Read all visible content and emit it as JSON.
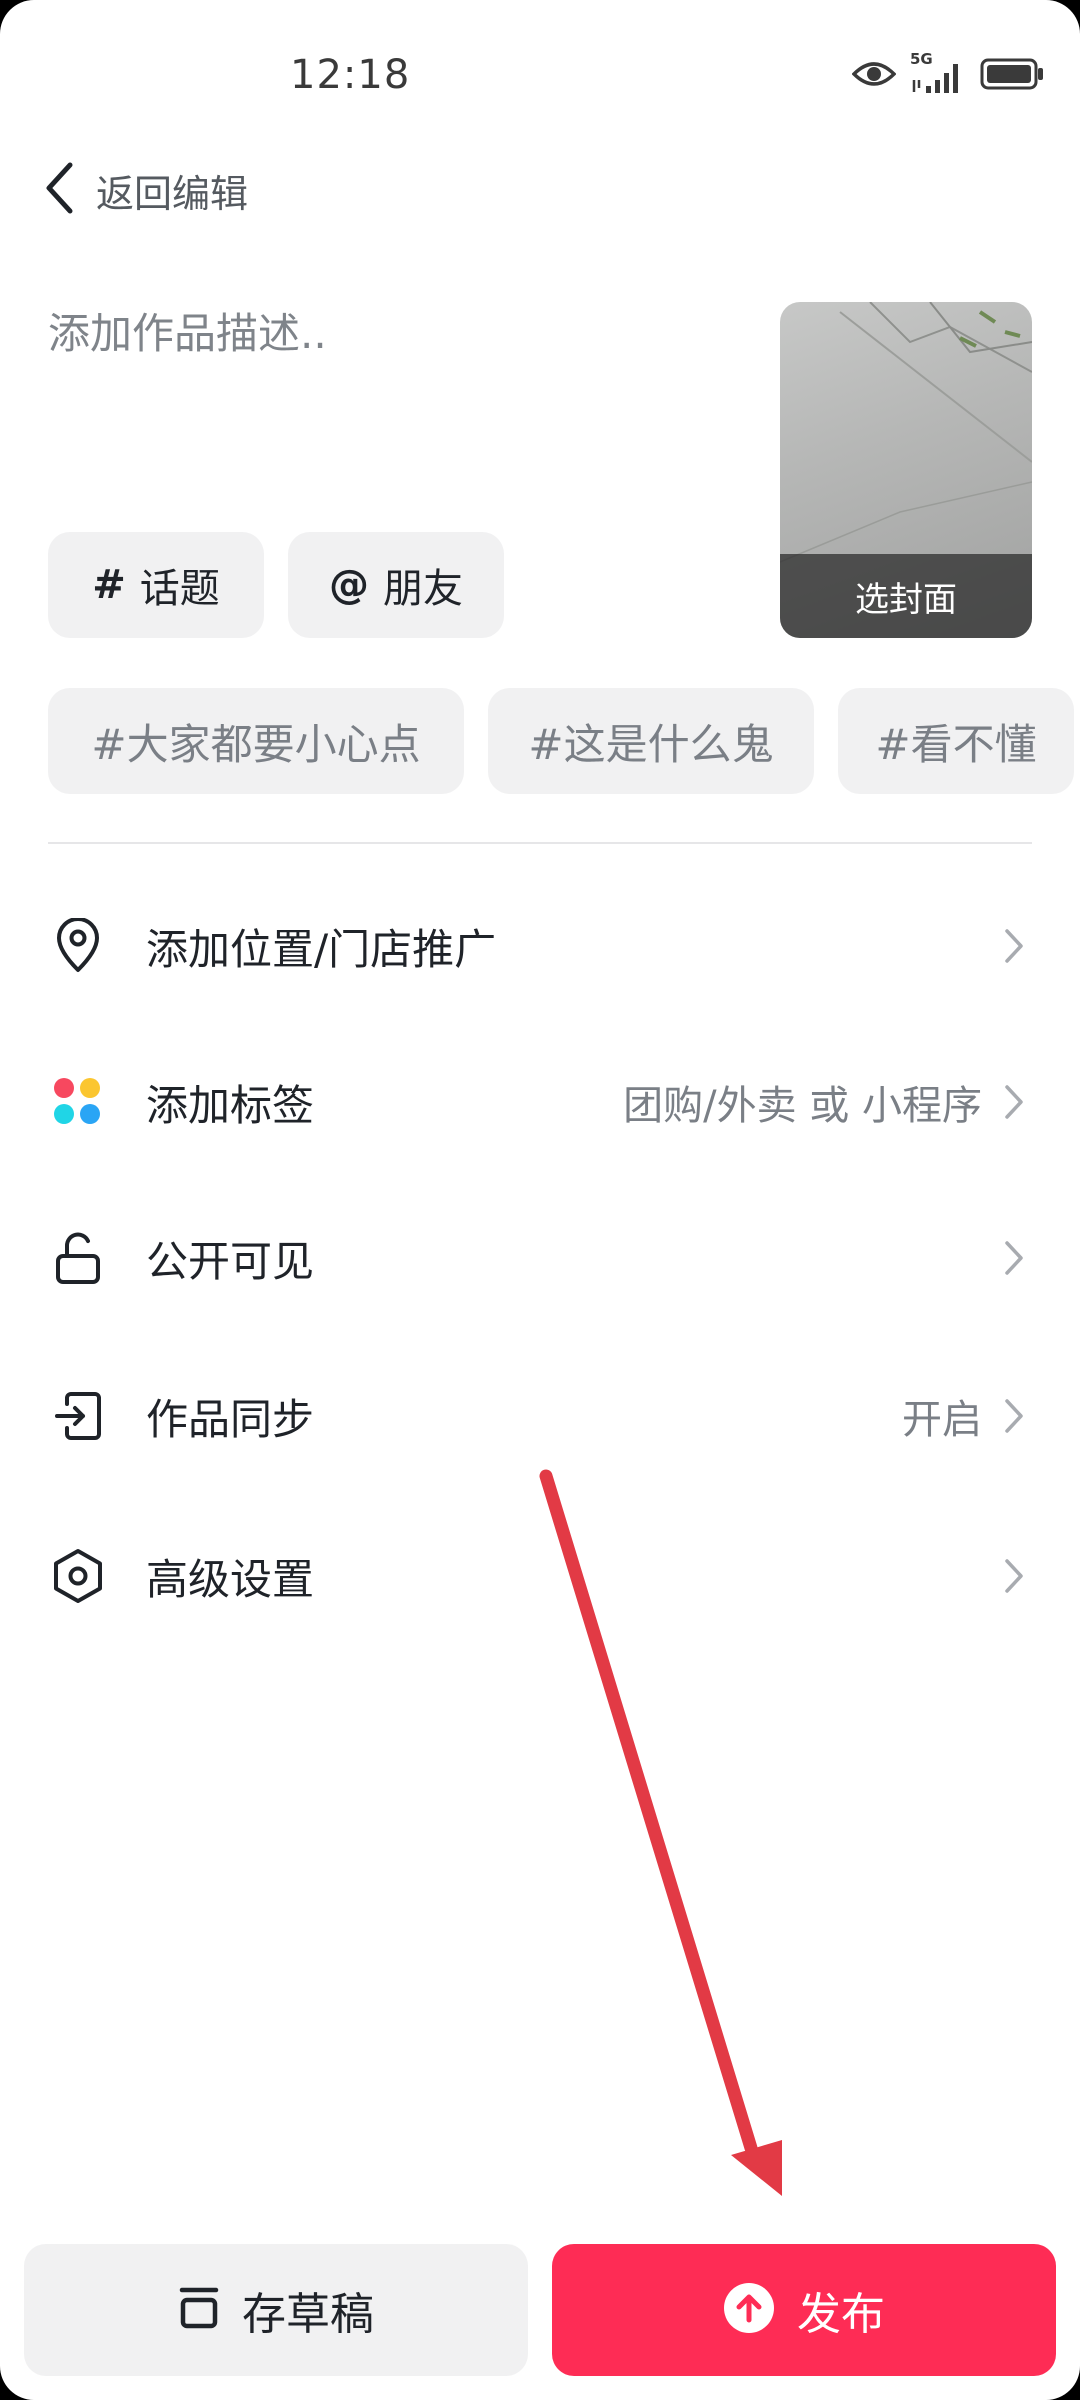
{
  "status_bar": {
    "time": "12:18",
    "network": "5G",
    "icons": [
      "eye-icon",
      "signal-5g-icon",
      "battery-icon"
    ]
  },
  "header": {
    "back_label": "返回编辑"
  },
  "description": {
    "placeholder": "添加作品描述.."
  },
  "cover": {
    "label": "选封面"
  },
  "mention_chips": [
    {
      "symbol": "#",
      "label": "话题"
    },
    {
      "symbol": "@",
      "label": "朋友"
    }
  ],
  "topic_chips": [
    "#大家都要小心点",
    "#这是什么鬼",
    "#看不懂"
  ],
  "settings": [
    {
      "icon": "location-pin-icon",
      "label": "添加位置/门店推广",
      "value": ""
    },
    {
      "icon": "colorful-dots-icon",
      "label": "添加标签",
      "value": "团购/外卖 或 小程序"
    },
    {
      "icon": "unlock-icon",
      "label": "公开可见",
      "value": ""
    },
    {
      "icon": "sync-export-icon",
      "label": "作品同步",
      "value": "开启"
    },
    {
      "icon": "hexagon-settings-icon",
      "label": "高级设置",
      "value": ""
    }
  ],
  "bottom": {
    "draft_label": "存草稿",
    "publish_label": "发布"
  },
  "colors": {
    "accent": "#fe2c55",
    "annotation_arrow": "#e23a45",
    "chip_bg": "#f1f1f2"
  }
}
